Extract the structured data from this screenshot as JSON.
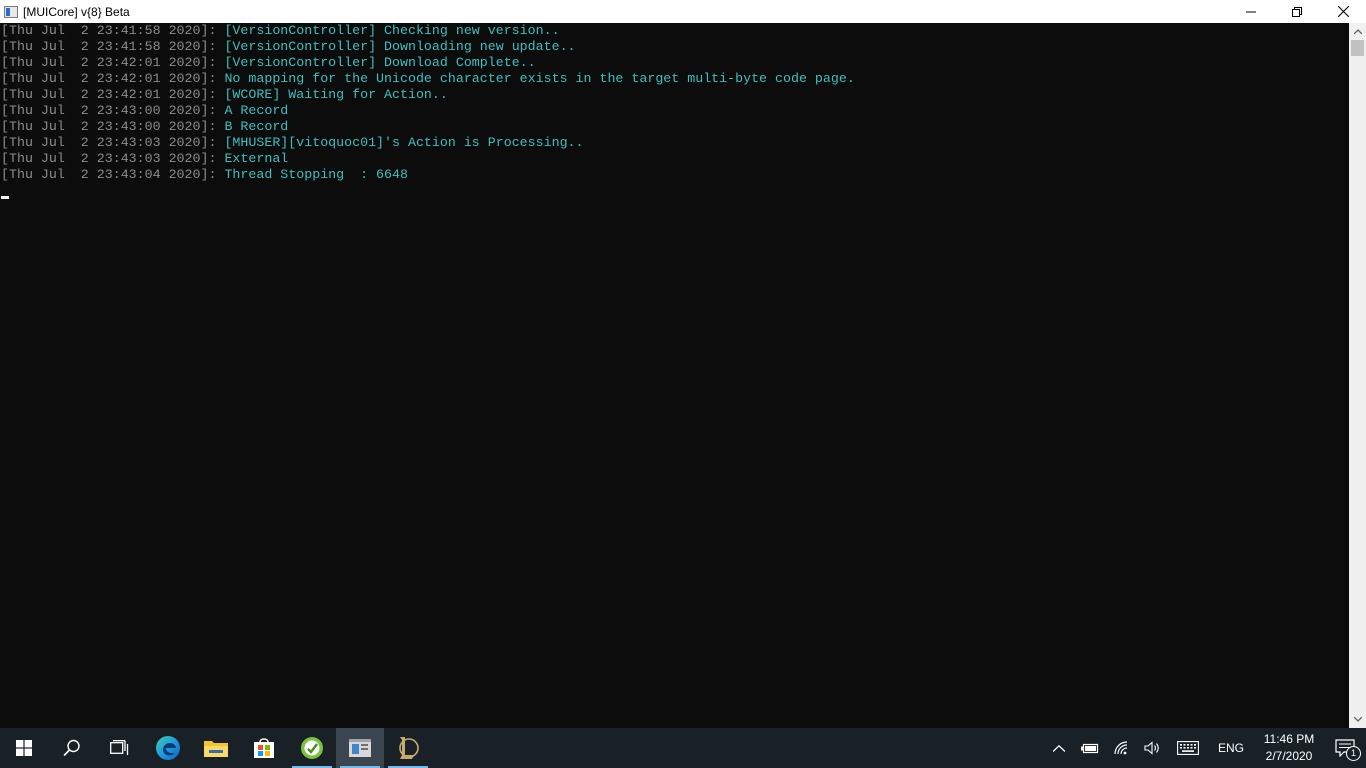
{
  "window": {
    "title": "[MUICore] v{8} Beta",
    "icon": "console-app-icon"
  },
  "console": {
    "lines": [
      {
        "ts": "[Thu Jul  2 23:41:58 2020]",
        "msg": "[VersionController] Checking new version.."
      },
      {
        "ts": "[Thu Jul  2 23:41:58 2020]",
        "msg": "[VersionController] Downloading new update.."
      },
      {
        "ts": "[Thu Jul  2 23:42:01 2020]",
        "msg": "[VersionController] Download Complete.."
      },
      {
        "ts": "[Thu Jul  2 23:42:01 2020]",
        "msg": "No mapping for the Unicode character exists in the target multi-byte code page."
      },
      {
        "ts": "[Thu Jul  2 23:42:01 2020]",
        "msg": "[WCORE] Waiting for Action.."
      },
      {
        "ts": "[Thu Jul  2 23:43:00 2020]",
        "msg": "A Record"
      },
      {
        "ts": "[Thu Jul  2 23:43:00 2020]",
        "msg": "B Record"
      },
      {
        "ts": "[Thu Jul  2 23:43:03 2020]",
        "msg": "[MHUSER][vitoquoc01]'s Action is Processing.."
      },
      {
        "ts": "[Thu Jul  2 23:43:03 2020]",
        "msg": "External"
      },
      {
        "ts": "[Thu Jul  2 23:43:04 2020]",
        "msg": "Thread Stopping  : 6648"
      }
    ],
    "separator": ": "
  },
  "taskbar": {
    "apps": [
      {
        "name": "start-windows-icon"
      },
      {
        "name": "search-icon"
      },
      {
        "name": "task-view-icon"
      },
      {
        "name": "edge-browser-icon"
      },
      {
        "name": "file-explorer-icon"
      },
      {
        "name": "store-icon"
      },
      {
        "name": "green-app-icon"
      },
      {
        "name": "console-window-icon"
      },
      {
        "name": "league-client-icon"
      }
    ],
    "tray": {
      "language": "ENG",
      "time": "11:46 PM",
      "date": "2/7/2020",
      "notification_count": "1"
    }
  },
  "colors": {
    "console_bg": "#0c0c0c",
    "timestamp": "#8c8c8c",
    "message": "#3fbfbf",
    "taskbar_bg": "#192127"
  }
}
